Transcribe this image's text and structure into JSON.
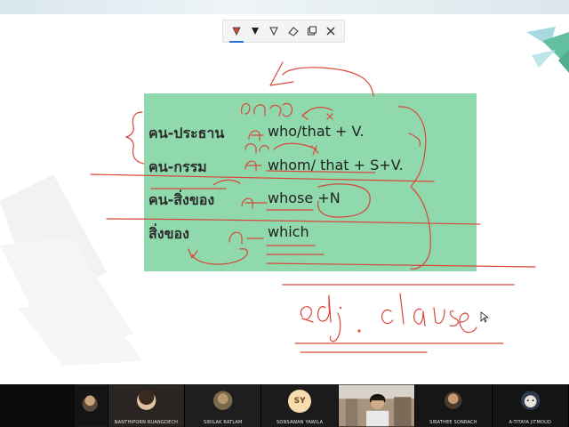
{
  "toolbar": {
    "tools": [
      {
        "icon": "pen-icon",
        "active": true
      },
      {
        "icon": "marker-icon",
        "active": false
      },
      {
        "icon": "highlighter-icon",
        "active": false
      },
      {
        "icon": "eraser-icon",
        "active": false
      },
      {
        "icon": "copy-icon",
        "active": false
      },
      {
        "icon": "close-icon",
        "active": false
      }
    ]
  },
  "slide": {
    "rows": [
      {
        "thai": "คน-ประธาน",
        "english": "who/that + V."
      },
      {
        "thai": "คน-กรรม",
        "english": "whom/ that + S+V."
      },
      {
        "thai": "คน-สิ่งของ",
        "english": "whose +N"
      },
      {
        "thai": "สิ่งของ",
        "english": "which"
      }
    ]
  },
  "handwriting": {
    "main": "adj. clause",
    "note_row1": "คน",
    "note_row2": "คน"
  },
  "participants": [
    {
      "name": "",
      "type": "video"
    },
    {
      "name": "NANTHIPORN RUANGDECH",
      "type": "video"
    },
    {
      "name": "SIRILAK RATLAM",
      "type": "video"
    },
    {
      "name": "SONSAWAN YAWILA",
      "type": "initials",
      "initials": "SY"
    },
    {
      "name": "",
      "type": "video"
    },
    {
      "name": "SIRATHEE SONRACH",
      "type": "video"
    },
    {
      "name": "A-TITAYA JITMOUD",
      "type": "video"
    }
  ],
  "colors": {
    "slide_green": "#8fd9ac",
    "ink": "#d8483b",
    "toolbar_active": "#2a6fd6"
  }
}
